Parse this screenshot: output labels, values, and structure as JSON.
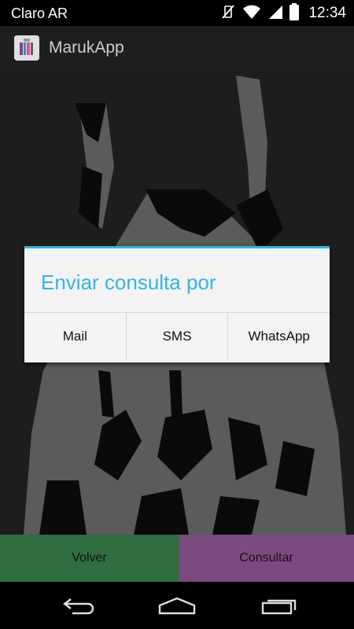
{
  "status_bar": {
    "carrier": "Claro AR",
    "time": "12:34",
    "icons": [
      "vibrate-off-icon",
      "wifi-icon",
      "signal-icon",
      "battery-icon"
    ]
  },
  "action_bar": {
    "title": "MarukApp",
    "icon": "app-icon"
  },
  "dialog": {
    "title": "Enviar consulta por",
    "buttons": [
      {
        "label": "Mail"
      },
      {
        "label": "SMS"
      },
      {
        "label": "WhatsApp"
      }
    ],
    "accent_color": "#33b5e5"
  },
  "bottom_buttons": {
    "back_label": "Volver",
    "consult_label": "Consultar",
    "back_color": "#2e6e3f",
    "consult_color": "#7b4a7f"
  },
  "nav_bar": {
    "icons": [
      "back-icon",
      "home-icon",
      "recents-icon"
    ]
  }
}
